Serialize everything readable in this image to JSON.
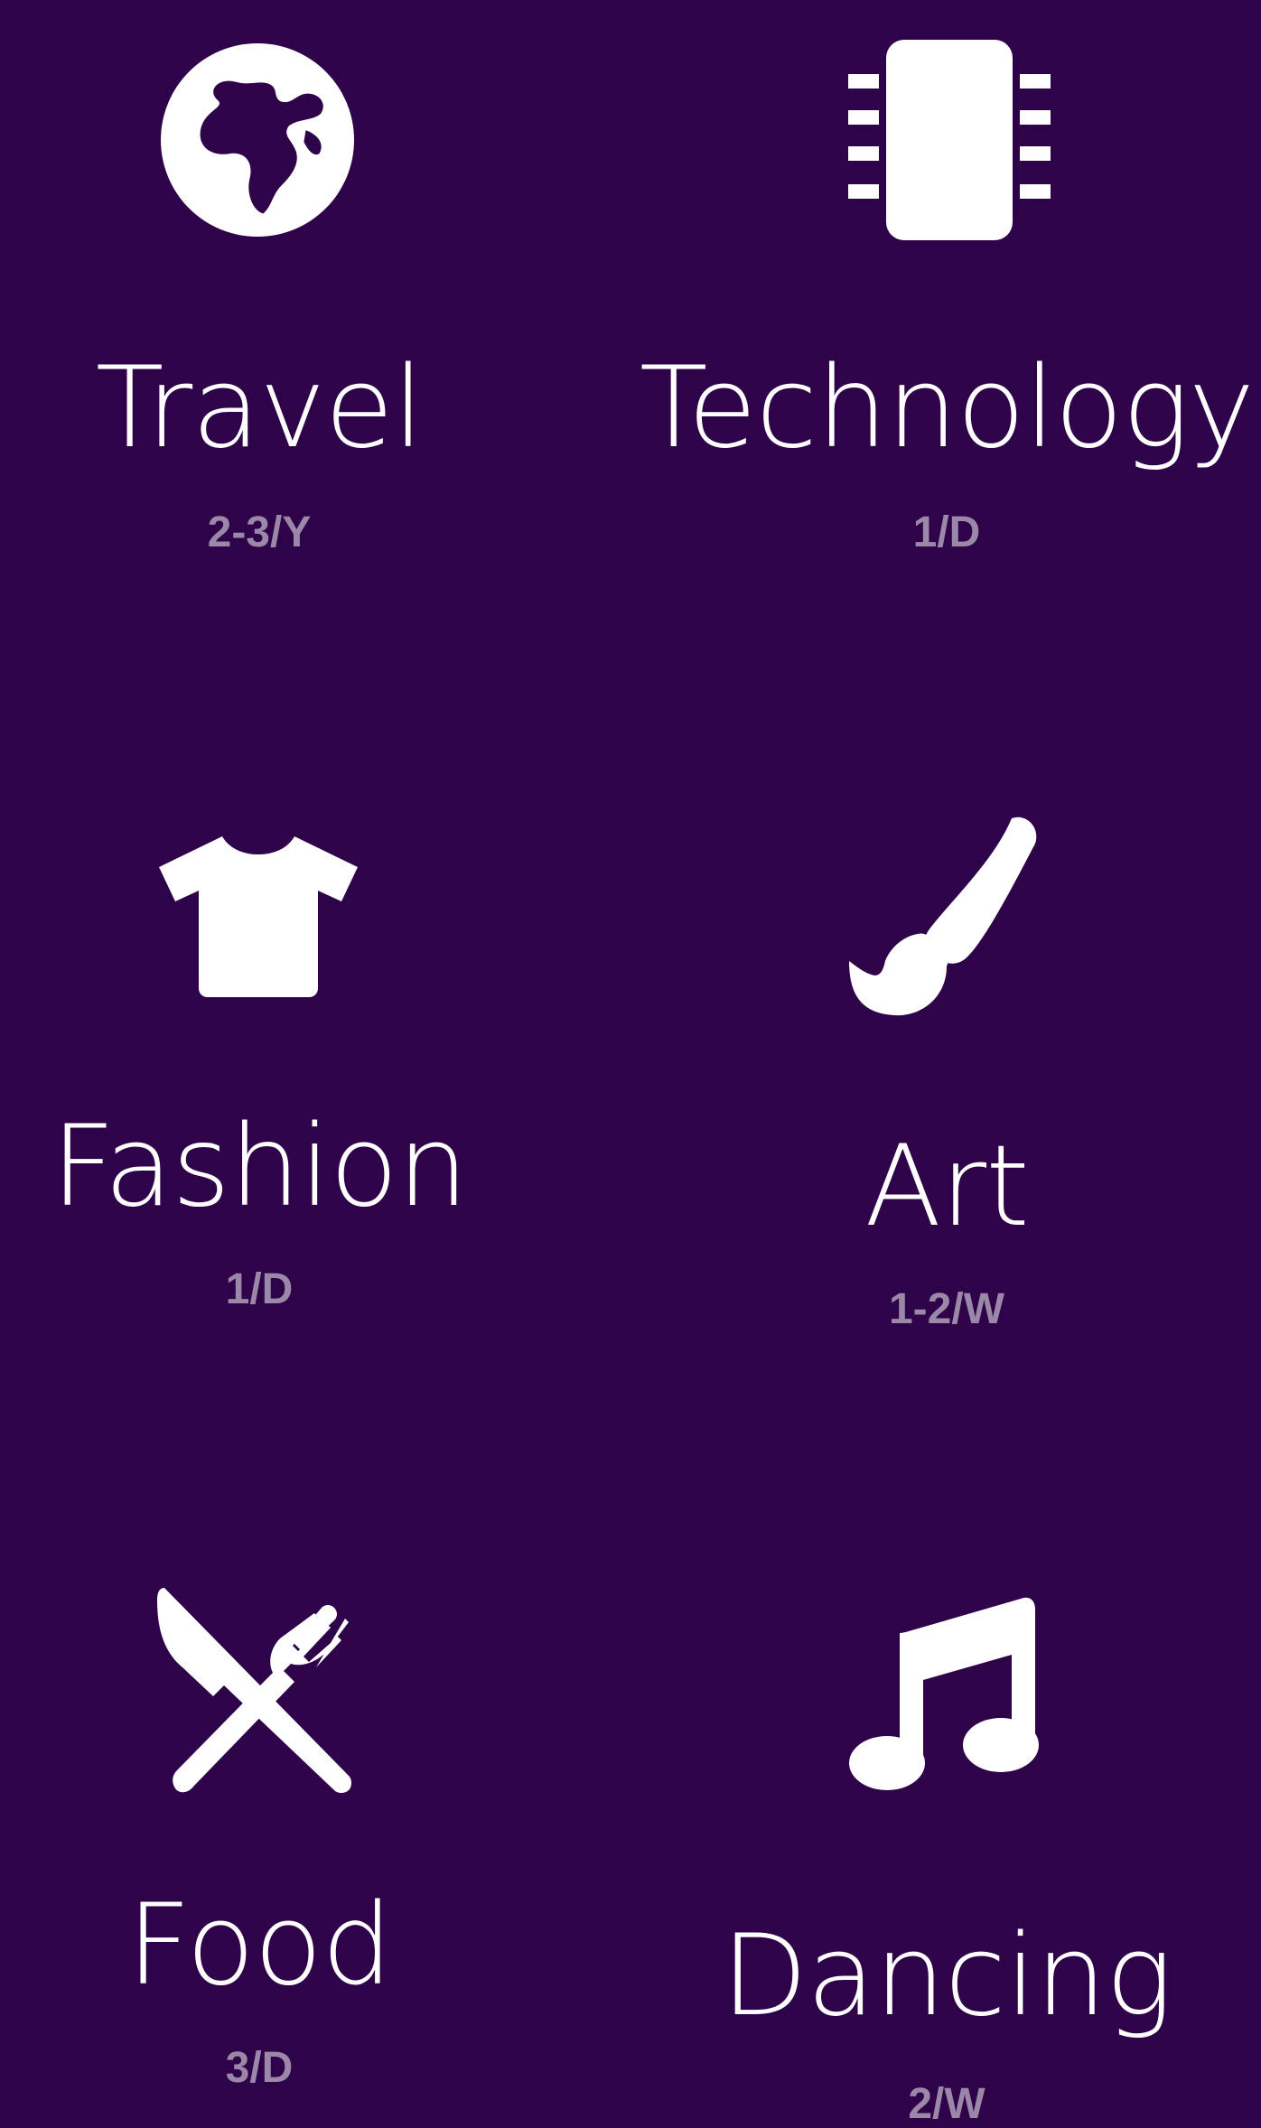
{
  "theme": {
    "background": "#2f034a",
    "icon_color": "#ffffff",
    "label_color": "#ffffff",
    "frequency_color": "#9b87a8"
  },
  "categories": [
    {
      "label": "Travel",
      "frequency": "2-3/Y",
      "icon": "globe-icon"
    },
    {
      "label": "Technology",
      "frequency": "1/D",
      "icon": "chip-icon"
    },
    {
      "label": "Fashion",
      "frequency": "1/D",
      "icon": "tshirt-icon"
    },
    {
      "label": "Art",
      "frequency": "1-2/W",
      "icon": "paintbrush-icon"
    },
    {
      "label": "Food",
      "frequency": "3/D",
      "icon": "cutlery-icon"
    },
    {
      "label": "Dancing",
      "frequency": "2/W",
      "icon": "music-note-icon"
    }
  ]
}
